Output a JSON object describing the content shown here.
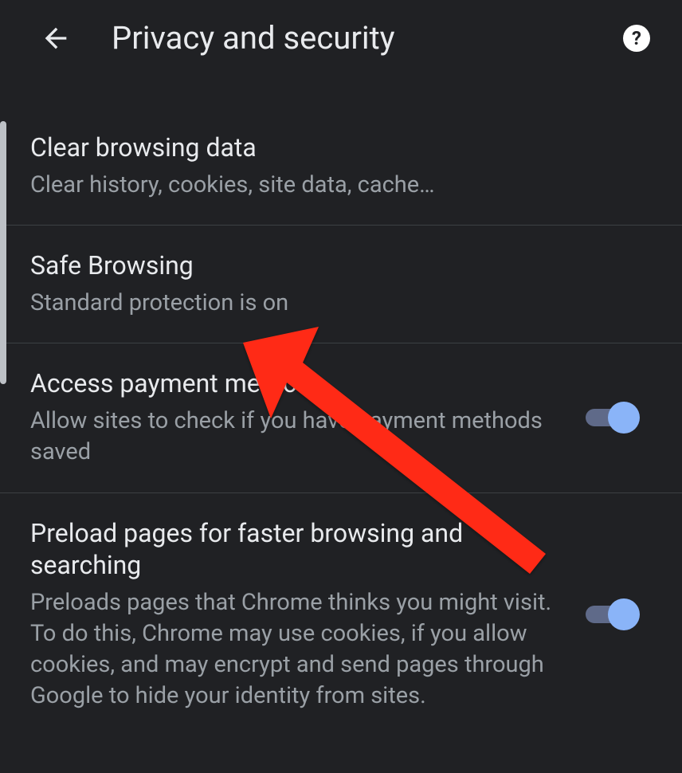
{
  "header": {
    "title": "Privacy and security"
  },
  "settings": [
    {
      "title": "Clear browsing data",
      "subtitle": "Clear history, cookies, site data, cache…",
      "hasToggle": false
    },
    {
      "title": "Safe Browsing",
      "subtitle": "Standard protection is on",
      "hasToggle": false
    },
    {
      "title": "Access payment methods",
      "subtitle": "Allow sites to check if you have payment methods saved",
      "hasToggle": true
    },
    {
      "title": "Preload pages for faster browsing and searching",
      "subtitle": "Preloads pages that Chrome thinks you might visit. To do this, Chrome may use cookies, if you allow cookies, and may encrypt and send pages through Google to hide your identity from sites.",
      "hasToggle": true
    }
  ]
}
